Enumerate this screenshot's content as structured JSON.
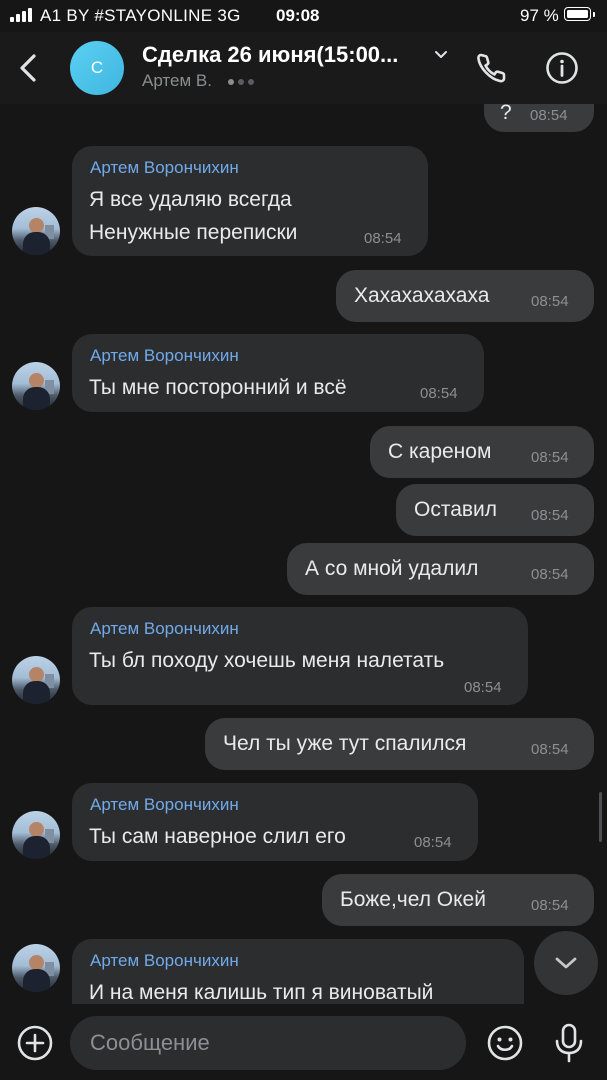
{
  "status_bar": {
    "carrier": "A1 BY #STAYONLINE  3G",
    "time": "09:08",
    "battery": "97 %"
  },
  "header": {
    "avatar_letter": "С",
    "title": "Сделка 26 июня(15:00...",
    "subtitle": "Артем В."
  },
  "messages": [
    {
      "dir": "out",
      "lines": [
        "?"
      ],
      "time": "08:54"
    },
    {
      "dir": "in",
      "sender": "Артем Ворончихин",
      "lines": [
        "Я все удаляю всегда",
        "Ненужные переписки"
      ],
      "time": "08:54"
    },
    {
      "dir": "out",
      "lines": [
        "Хахахахахаха"
      ],
      "time": "08:54"
    },
    {
      "dir": "in",
      "sender": "Артем Ворончихин",
      "lines": [
        "Ты мне посторонний и всё"
      ],
      "time": "08:54"
    },
    {
      "dir": "out",
      "lines": [
        "С кареном"
      ],
      "time": "08:54"
    },
    {
      "dir": "out",
      "lines": [
        "Оставил"
      ],
      "time": "08:54"
    },
    {
      "dir": "out",
      "lines": [
        "А со мной удалил"
      ],
      "time": "08:54"
    },
    {
      "dir": "in",
      "sender": "Артем Ворончихин",
      "lines": [
        "Ты бл походу хочешь меня налетать"
      ],
      "time": "08:54"
    },
    {
      "dir": "out",
      "lines": [
        "Чел ты уже тут спалился"
      ],
      "time": "08:54"
    },
    {
      "dir": "in",
      "sender": "Артем Ворончихин",
      "lines": [
        "Ты сам наверное слил его"
      ],
      "time": "08:54"
    },
    {
      "dir": "out",
      "lines": [
        "Боже,чел Окей"
      ],
      "time": "08:54"
    },
    {
      "dir": "in",
      "sender": "Артем Ворончихин",
      "lines": [
        "И на меня калишь тип я виноватый"
      ],
      "time": ""
    }
  ],
  "composer": {
    "placeholder": "Сообщение"
  },
  "colors": {
    "background": "#161616",
    "bubble_in": "#2c2d2e",
    "bubble_out": "#3a3b3c",
    "sender_name": "#71aaeb",
    "timestamp": "#8c8f93"
  },
  "icons": {
    "back": "chevron-left-icon",
    "call": "phone-icon",
    "info": "info-icon",
    "attach": "plus-circle-icon",
    "emoji": "smile-icon",
    "mic": "microphone-icon",
    "scroll": "chevron-down-icon"
  }
}
